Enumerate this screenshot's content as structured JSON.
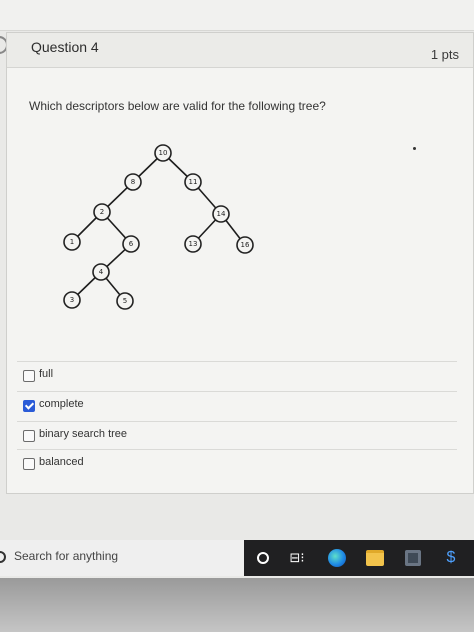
{
  "question": {
    "title": "Question 4",
    "points": "1 pts",
    "prompt": "Which descriptors below are valid for the following tree?"
  },
  "tree": {
    "nodes": [
      "10",
      "8",
      "11",
      "2",
      "14",
      "1",
      "6",
      "13",
      "16",
      "4",
      "3",
      "5"
    ]
  },
  "options": [
    {
      "label": "full",
      "checked": false
    },
    {
      "label": "complete",
      "checked": true
    },
    {
      "label": "binary search tree",
      "checked": false
    },
    {
      "label": "balanced",
      "checked": false
    }
  ],
  "taskbar": {
    "search_placeholder": "Search for anything",
    "taskview_glyph": "⊟⁝",
    "app5_glyph": "$"
  },
  "colors": {
    "checkbox_checked": "#2a5bd7",
    "taskbar": "#202022"
  }
}
